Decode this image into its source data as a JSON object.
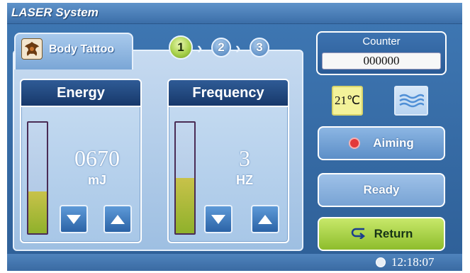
{
  "app": {
    "title": "LASER System"
  },
  "mode": {
    "label": "Body Tattoo",
    "icon": "tattoo-icon"
  },
  "steps": [
    {
      "label": "1",
      "active": true
    },
    {
      "label": "2",
      "active": false
    },
    {
      "label": "3",
      "active": false
    }
  ],
  "energy": {
    "title": "Energy",
    "value": "0670",
    "unit": "mJ",
    "level": 0.38
  },
  "frequency": {
    "title": "Frequency",
    "value": "3",
    "unit": "HZ",
    "level": 0.5
  },
  "counter": {
    "label": "Counter",
    "value": "000000"
  },
  "temperature": {
    "value": "21℃"
  },
  "water": {
    "icon": "water-icon"
  },
  "buttons": {
    "aiming": "Aiming",
    "ready": "Ready",
    "return": "Return"
  },
  "clock": {
    "time": "12:18:07"
  },
  "colors": {
    "accent_green": "#8dbd2c",
    "header_navy": "#17386a",
    "panel_blue": "#3f78b4"
  }
}
